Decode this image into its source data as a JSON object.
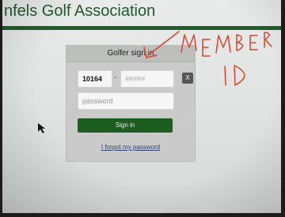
{
  "header": {
    "title": "nfels Golf Association"
  },
  "dialog": {
    "title": "Golfer sign in",
    "club_number_value": "10164",
    "separator": "-",
    "member_id_placeholder": "#####",
    "clear_label": "X",
    "password_placeholder": "password",
    "signin_label": "Sign in",
    "forgot_label": "I forgot my password"
  },
  "annotation": {
    "line1": "MEMBER",
    "line2": "ID",
    "color": "#d8452e"
  },
  "colors": {
    "brand_green": "#1f5d2c",
    "button_green": "#1d5d22"
  }
}
